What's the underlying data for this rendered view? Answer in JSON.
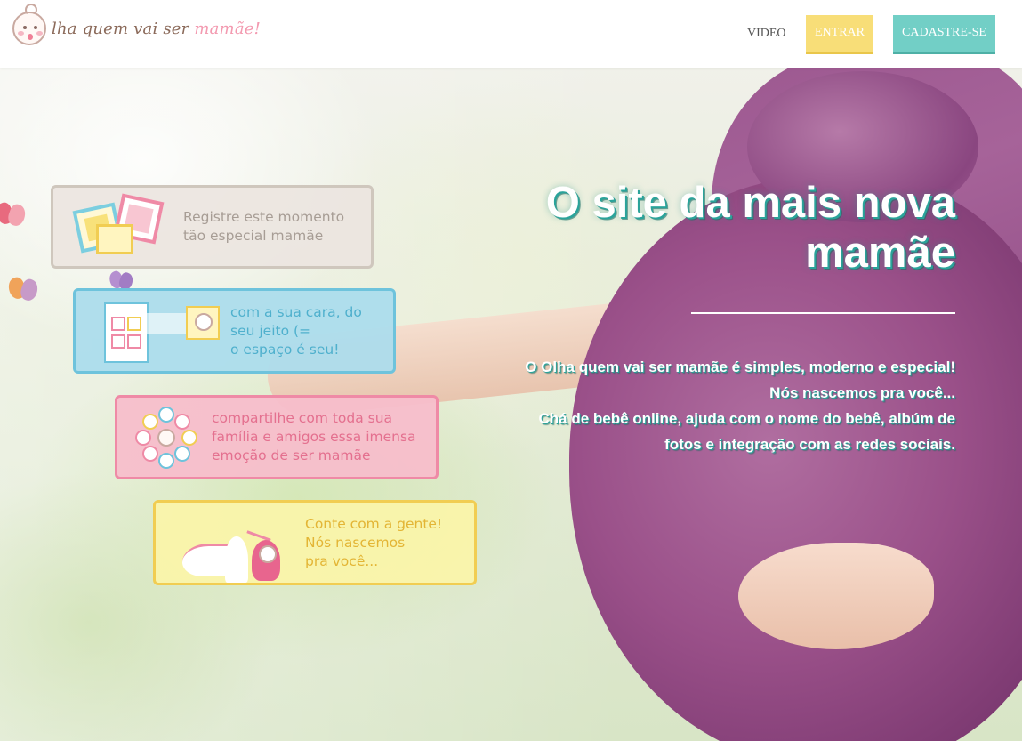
{
  "brand": {
    "logo_text_main": "lha quem vai ser",
    "logo_text_accent": "mamãe!",
    "colors": {
      "yellow": "#f8de78",
      "teal": "#72cfc6",
      "pink": "#f39ab0",
      "blue": "#6ec3dc"
    }
  },
  "nav": {
    "video_label": "VIDEO",
    "entrar_label": "ENTRAR",
    "cadastre_label": "CADASTRE-SE"
  },
  "features": [
    {
      "text": "Registre este momento\ntão especial mamãe"
    },
    {
      "text": "com a sua cara, do\nseu jeito (=\no espaço é seu!"
    },
    {
      "text": "compartilhe com toda sua\nfamília e amigos essa imensa\nemoção de ser mamãe"
    },
    {
      "text": "Conte com a gente!\nNós nascemos\npra você..."
    }
  ],
  "hero": {
    "title": "O site da mais nova mamãe",
    "body_line1": "O Olha quem vai ser mamãe é simples, moderno e especial! Nós nascemos pra você...",
    "body_line2": "Chá de bebê online, ajuda com o nome do bebê, albúm de fotos e integração com as redes sociais."
  }
}
